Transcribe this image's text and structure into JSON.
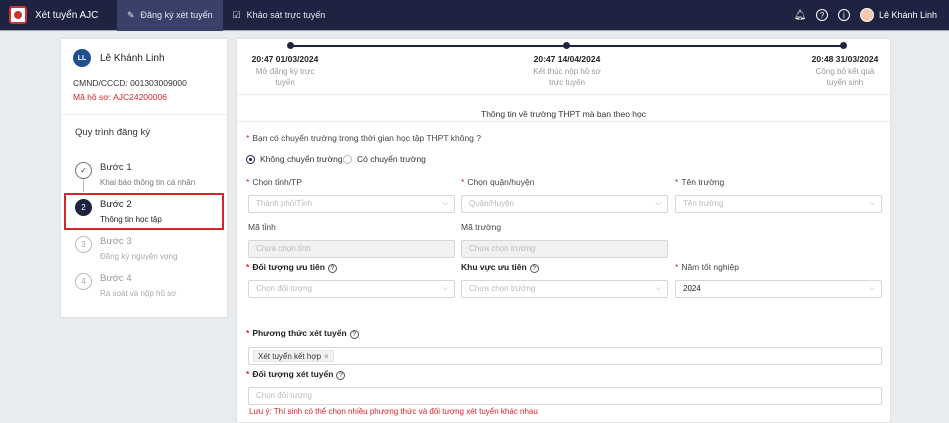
{
  "header": {
    "app_title": "Xét tuyển AJC",
    "tabs": [
      {
        "label": "Đăng ký xét tuyển"
      },
      {
        "label": "Khảo sát trực tuyến"
      }
    ],
    "user_name": "Lê Khánh Linh"
  },
  "sidebar": {
    "avatar_initials": "LL",
    "name": "Lê Khánh Linh",
    "cmnd": "CMND/CCCD: 001303009000",
    "profile_code": "Mã hồ sơ: AJC24200006",
    "process_title": "Quy trình đăng ký",
    "steps": [
      {
        "num": "✓",
        "title": "Bước 1",
        "desc": "Khai báo thông tin cá nhân"
      },
      {
        "num": "2",
        "title": "Bước 2",
        "desc": "Thông tin học tập"
      },
      {
        "num": "3",
        "title": "Bước 3",
        "desc": "Đăng ký nguyện vọng"
      },
      {
        "num": "4",
        "title": "Bước 4",
        "desc": "Rà soát và nộp hồ sơ"
      }
    ]
  },
  "timeline": [
    {
      "date": "20:47 01/03/2024",
      "desc1": "Mở đăng ký trực",
      "desc2": "tuyến"
    },
    {
      "date": "20:47 14/04/2024",
      "desc1": "Kết thúc nộp hồ sơ",
      "desc2": "trực tuyến"
    },
    {
      "date": "20:48 31/03/2024",
      "desc1": "Công bố kết quả",
      "desc2": "tuyển sinh"
    }
  ],
  "form": {
    "section_title": "Thông tin về trường THPT mà bạn theo học",
    "transfer_question": "Bạn có chuyển trường trong thời gian học tập THPT không ?",
    "radio_no": "Không chuyển trường",
    "radio_yes": "Có chuyển trường",
    "province_label": "Chọn tỉnh/TP",
    "province_placeholder": "Thành phố/Tỉnh",
    "district_label": "Chọn quận/huyện",
    "district_placeholder": "Quận/Huyện",
    "school_label": "Tên trường",
    "school_placeholder": "Tên trường",
    "province_code_label": "Mã tỉnh",
    "province_code_value": "Chưa chọn tỉnh",
    "school_code_label": "Mã trường",
    "school_code_value": "Chưa chọn trường",
    "priority_label": "Đối tượng ưu tiên",
    "priority_placeholder": "Chọn đối tượng",
    "area_label": "Khu vực ưu tiên",
    "area_placeholder": "Chưa chọn trường",
    "grad_year_label": "Năm tốt nghiệp",
    "grad_year_value": "2024",
    "method_label": "Phương thức xét tuyển",
    "method_tag": "Xét tuyển kết hợp",
    "target_label": "Đối tượng xét tuyển",
    "target_placeholder": "Chọn đối tượng",
    "note": "Lưu ý: Thí sinh có thể chọn nhiều phương thức và đối tượng xét tuyển khác nhau"
  }
}
